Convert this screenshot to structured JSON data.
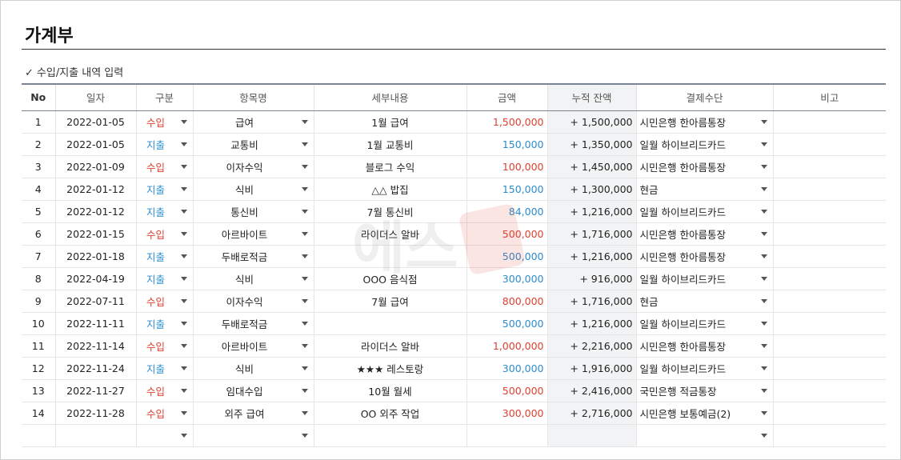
{
  "title": "가계부",
  "section_label": "수입/지출 내역 입력",
  "check_glyph": "✓",
  "columns": [
    "No",
    "일자",
    "구분",
    "항목명",
    "세부내용",
    "금액",
    "누적 잔액",
    "결제수단",
    "비고"
  ],
  "colors": {
    "income": "#e04030",
    "expense": "#2a8cd0",
    "header_rule": "#7a8591"
  },
  "rows": [
    {
      "no": "1",
      "date": "2022-01-05",
      "type": "수입",
      "kind": "income",
      "category": "급여",
      "detail": "1월 급여",
      "amount": "1,500,000",
      "balance": "+ 1,500,000",
      "payment": "시민은행 한아름통장",
      "note": ""
    },
    {
      "no": "2",
      "date": "2022-01-05",
      "type": "지출",
      "kind": "expense",
      "category": "교통비",
      "detail": "1월 교통비",
      "amount": "150,000",
      "balance": "+ 1,350,000",
      "payment": "일월 하이브리드카드",
      "note": ""
    },
    {
      "no": "3",
      "date": "2022-01-09",
      "type": "수입",
      "kind": "income",
      "category": "이자수익",
      "detail": "블로그 수익",
      "amount": "100,000",
      "balance": "+ 1,450,000",
      "payment": "시민은행 한아름통장",
      "note": ""
    },
    {
      "no": "4",
      "date": "2022-01-12",
      "type": "지출",
      "kind": "expense",
      "category": "식비",
      "detail": "△△ 밥집",
      "amount": "150,000",
      "balance": "+ 1,300,000",
      "payment": "현금",
      "note": ""
    },
    {
      "no": "5",
      "date": "2022-01-12",
      "type": "지출",
      "kind": "expense",
      "category": "통신비",
      "detail": "7월 통신비",
      "amount": "84,000",
      "balance": "+ 1,216,000",
      "payment": "일월 하이브리드카드",
      "note": ""
    },
    {
      "no": "6",
      "date": "2022-01-15",
      "type": "수입",
      "kind": "income",
      "category": "아르바이트",
      "detail": "라이더스 알바",
      "amount": "500,000",
      "balance": "+ 1,716,000",
      "payment": "시민은행 한아름통장",
      "note": ""
    },
    {
      "no": "7",
      "date": "2022-01-18",
      "type": "지출",
      "kind": "expense",
      "category": "두배로적금",
      "detail": "",
      "amount": "500,000",
      "balance": "+ 1,216,000",
      "payment": "시민은행 한아름통장",
      "note": ""
    },
    {
      "no": "8",
      "date": "2022-04-19",
      "type": "지출",
      "kind": "expense",
      "category": "식비",
      "detail": "OOO 음식점",
      "amount": "300,000",
      "balance": "+ 916,000",
      "payment": "일월 하이브리드카드",
      "note": ""
    },
    {
      "no": "9",
      "date": "2022-07-11",
      "type": "수입",
      "kind": "income",
      "category": "이자수익",
      "detail": "7월 급여",
      "amount": "800,000",
      "balance": "+ 1,716,000",
      "payment": "현금",
      "note": ""
    },
    {
      "no": "10",
      "date": "2022-11-11",
      "type": "지출",
      "kind": "expense",
      "category": "두배로적금",
      "detail": "",
      "amount": "500,000",
      "balance": "+ 1,216,000",
      "payment": "일월 하이브리드카드",
      "note": ""
    },
    {
      "no": "11",
      "date": "2022-11-14",
      "type": "수입",
      "kind": "income",
      "category": "아르바이트",
      "detail": "라이더스 알바",
      "amount": "1,000,000",
      "balance": "+ 2,216,000",
      "payment": "시민은행 한아름통장",
      "note": ""
    },
    {
      "no": "12",
      "date": "2022-11-24",
      "type": "지출",
      "kind": "expense",
      "category": "식비",
      "detail": "★★★ 레스토랑",
      "amount": "300,000",
      "balance": "+ 1,916,000",
      "payment": "일월 하이브리드카드",
      "note": ""
    },
    {
      "no": "13",
      "date": "2022-11-27",
      "type": "수입",
      "kind": "income",
      "category": "임대수입",
      "detail": "10월 월세",
      "amount": "500,000",
      "balance": "+ 2,416,000",
      "payment": "국민은행 적금통장",
      "note": ""
    },
    {
      "no": "14",
      "date": "2022-11-28",
      "type": "수입",
      "kind": "income",
      "category": "외주 급여",
      "detail": "OO 외주 작업",
      "amount": "300,000",
      "balance": "+ 2,716,000",
      "payment": "시민은행 보통예금(2)",
      "note": ""
    },
    {
      "no": "",
      "date": "",
      "type": "",
      "kind": "",
      "category": "",
      "detail": "",
      "amount": "",
      "balance": "",
      "payment": "",
      "note": ""
    }
  ]
}
